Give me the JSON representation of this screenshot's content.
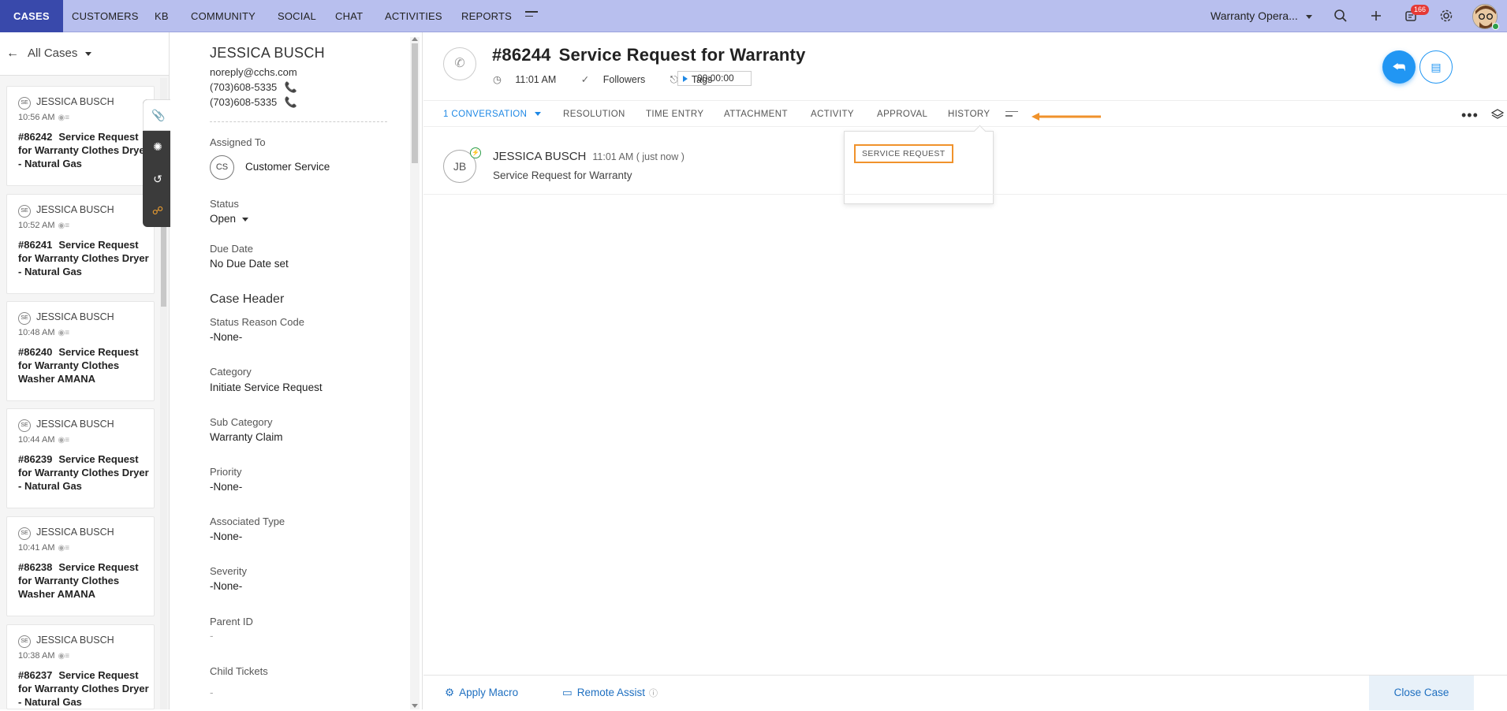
{
  "nav": {
    "tabs": [
      "CASES",
      "CUSTOMERS",
      "KB",
      "COMMUNITY",
      "SOCIAL",
      "CHAT",
      "ACTIVITIES",
      "REPORTS"
    ],
    "department": "Warranty Opera...",
    "notification_count": "166",
    "icons": [
      "menu-icon",
      "search-icon",
      "plus-icon",
      "notification-icon",
      "gear-icon",
      "avatar"
    ]
  },
  "case_list": {
    "title": "All Cases",
    "cards": [
      {
        "initials": "SE",
        "name": "JESSICA BUSCH",
        "time": "10:56 AM",
        "number": "#86242",
        "title": "Service Request for Warranty Clothes Dryer - Natural Gas"
      },
      {
        "initials": "SE",
        "name": "JESSICA BUSCH",
        "time": "10:52 AM",
        "number": "#86241",
        "title": "Service Request for Warranty Clothes Dryer - Natural Gas"
      },
      {
        "initials": "SE",
        "name": "JESSICA BUSCH",
        "time": "10:48 AM",
        "number": "#86240",
        "title": "Service Request for Warranty Clothes Washer AMANA"
      },
      {
        "initials": "SE",
        "name": "JESSICA BUSCH",
        "time": "10:44 AM",
        "number": "#86239",
        "title": "Service Request for Warranty Clothes Dryer - Natural Gas"
      },
      {
        "initials": "SE",
        "name": "JESSICA BUSCH",
        "time": "10:41 AM",
        "number": "#86238",
        "title": "Service Request for Warranty Clothes Washer AMANA"
      },
      {
        "initials": "SE",
        "name": "JESSICA BUSCH",
        "time": "10:38 AM",
        "number": "#86237",
        "title": "Service Request for Warranty Clothes Dryer - Natural Gas"
      }
    ]
  },
  "contact": {
    "name": "JESSICA BUSCH",
    "email": "noreply@cchs.com",
    "phone1": "(703)608-5335",
    "phone2": "(703)608-5335"
  },
  "details": {
    "assigned_to_label": "Assigned To",
    "assigned_initials": "CS",
    "assigned_to": "Customer Service",
    "status_label": "Status",
    "status": "Open",
    "due_date_label": "Due Date",
    "due_date": "No Due Date set",
    "section_title": "Case Header",
    "status_reason_label": "Status Reason Code",
    "status_reason": "-None-",
    "category_label": "Category",
    "category": "Initiate Service Request",
    "sub_category_label": "Sub Category",
    "sub_category": "Warranty Claim",
    "priority_label": "Priority",
    "priority": "-None-",
    "associated_type_label": "Associated Type",
    "associated_type": "-None-",
    "severity_label": "Severity",
    "severity": "-None-",
    "parent_id_label": "Parent ID",
    "parent_id": "-",
    "child_tickets_label": "Child Tickets",
    "child_tickets": "-"
  },
  "case": {
    "number": "#86244",
    "title": "Service Request for Warranty",
    "time": "11:01 AM",
    "followers_label": "Followers",
    "tags_label": "Tags",
    "timer": "00:00:00"
  },
  "tabs": {
    "conversation": "1  CONVERSATION",
    "resolution": "RESOLUTION",
    "time_entry": "TIME ENTRY",
    "attachment": "ATTACHMENT",
    "activity": "ACTIVITY",
    "approval": "APPROVAL",
    "history": "HISTORY"
  },
  "popup": {
    "item": "SERVICE REQUEST"
  },
  "thread": {
    "initials": "JB",
    "name": "JESSICA BUSCH",
    "time": "11:01 AM ( just now )",
    "text": "Service Request for Warranty"
  },
  "footer": {
    "apply_macro": "Apply Macro",
    "remote_assist": "Remote Assist",
    "close_case": "Close Case"
  },
  "colors": {
    "nav_bg": "#b8bfee",
    "nav_active": "#3949ab",
    "accent": "#2196f3",
    "highlight": "#f0922b"
  }
}
